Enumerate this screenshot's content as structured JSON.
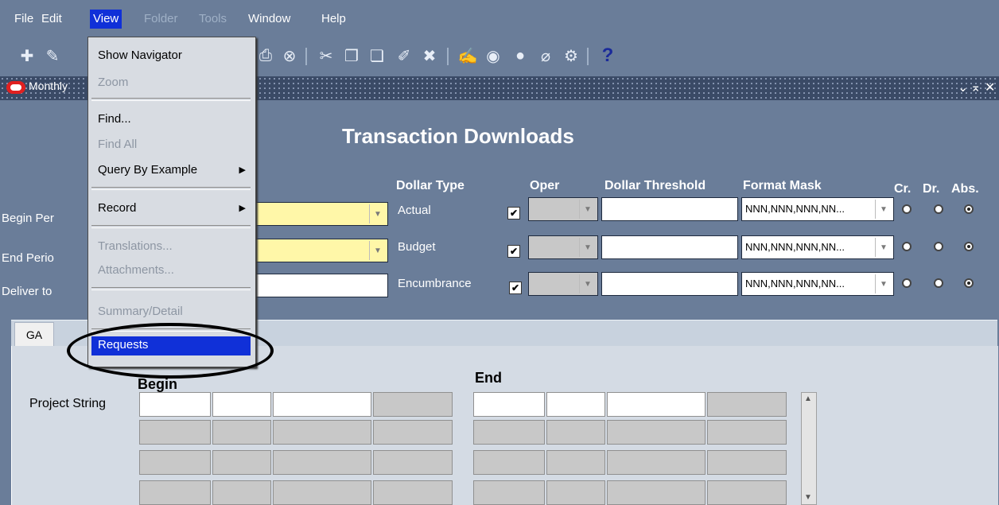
{
  "menubar": {
    "items": [
      {
        "label": "File",
        "state": "normal"
      },
      {
        "label": "Edit",
        "state": "normal"
      },
      {
        "label": "View",
        "state": "active"
      },
      {
        "label": "Folder",
        "state": "disabled"
      },
      {
        "label": "Tools",
        "state": "disabled"
      },
      {
        "label": "Window",
        "state": "normal"
      },
      {
        "label": "Help",
        "state": "normal"
      }
    ]
  },
  "toolbar": {
    "help_label": "?"
  },
  "window": {
    "title": "Monthly",
    "colors": {
      "titlebar": "#3a4a66",
      "form_bg": "#6a7d99",
      "menu_highlight": "#1030d8"
    }
  },
  "form": {
    "title": "Transaction Downloads",
    "labels": {
      "begin_period": "Begin Per",
      "end_period": "End Perio",
      "deliver_to": "Deliver to"
    },
    "headers": {
      "dollar_type": "Dollar Type",
      "oper": "Oper",
      "dollar_threshold": "Dollar Threshold",
      "format_mask": "Format Mask",
      "cr": "Cr.",
      "dr": "Dr.",
      "abs": "Abs."
    },
    "rows": [
      {
        "dollar_type": "Actual",
        "checked": true,
        "format_mask": "NNN,NNN,NNN,NN...",
        "radio": "abs"
      },
      {
        "dollar_type": "Budget",
        "checked": true,
        "format_mask": "NNN,NNN,NNN,NN...",
        "radio": "abs"
      },
      {
        "dollar_type": "Encumbrance",
        "checked": true,
        "format_mask": "NNN,NNN,NNN,NN...",
        "radio": "abs"
      }
    ]
  },
  "tabs": {
    "items": [
      {
        "label": "GA",
        "selected": true
      }
    ],
    "begin_header": "Begin",
    "end_header": "End",
    "project_string_label": "Project String"
  },
  "view_menu": {
    "show_navigator": "Show Navigator",
    "zoom": "Zoom",
    "find": "Find...",
    "find_all": "Find All",
    "query_by_example": "Query By Example",
    "record": "Record",
    "translations": "Translations...",
    "attachments": "Attachments...",
    "summary_detail": "Summary/Detail",
    "requests": "Requests"
  }
}
